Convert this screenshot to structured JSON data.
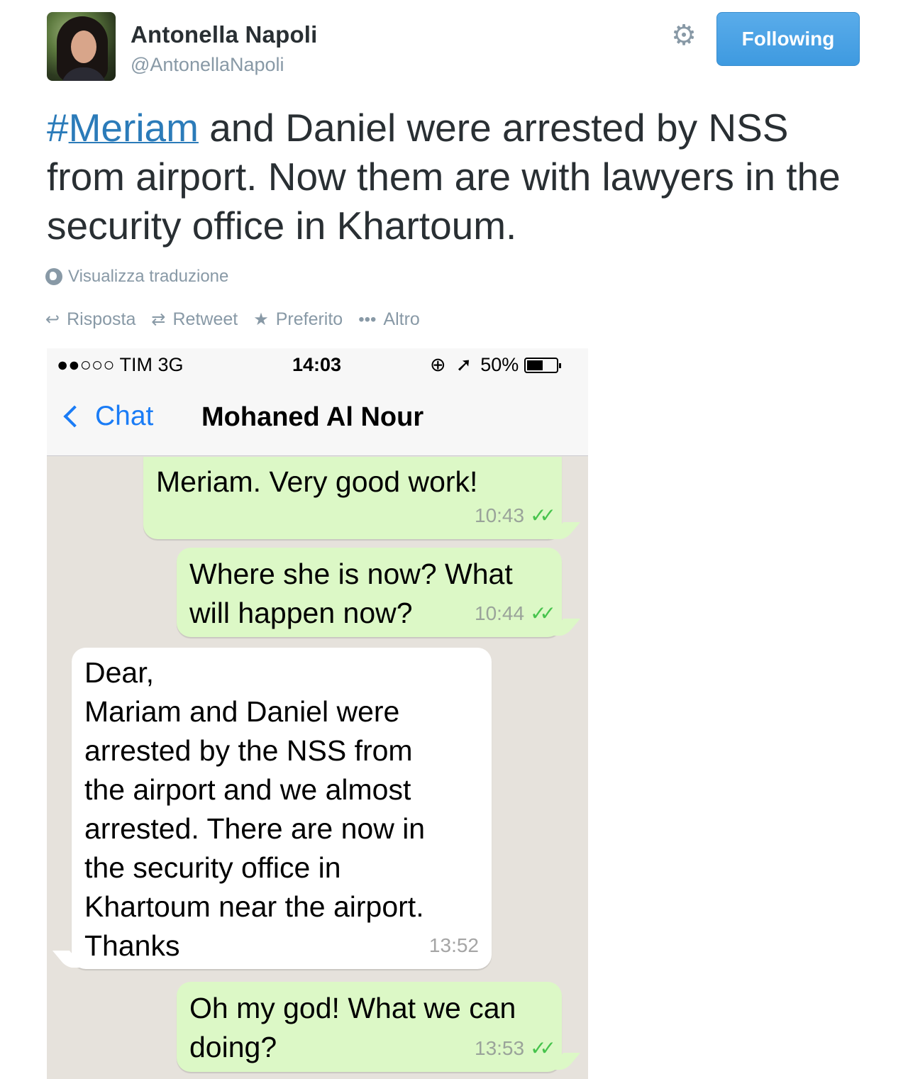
{
  "profile": {
    "name": "Antonella Napoli",
    "handle": "@AntonellaNapoli",
    "follow_label": "Following"
  },
  "tweet": {
    "hash": "#",
    "hashtag": "Meriam",
    "text": " and Daniel were arrested by NSS from airport. Now them are with lawyers in the security office in Khartoum.",
    "translate_label": "Visualizza traduzione"
  },
  "actions": {
    "reply": "Risposta",
    "retweet": "Retweet",
    "favorite": "Preferito",
    "more": "Altro"
  },
  "phone": {
    "status": {
      "carrier": "●●○○○ TIM   3G",
      "time": "14:03",
      "battery": "50%"
    },
    "nav": {
      "back_label": "Chat",
      "contact": "Mohaned Al Nour"
    },
    "messages": [
      {
        "direction": "out",
        "text": "Meriam. Very good work!",
        "time": "10:43"
      },
      {
        "direction": "out",
        "text": "Where she is now? What\nwill happen now?",
        "time": "10:44"
      },
      {
        "direction": "in",
        "text": "Dear,\nMariam and Daniel were\narrested by the NSS from\nthe airport and we almost\narrested. There are now in\nthe security office in\nKhartoum near the airport.\nThanks",
        "time": "13:52"
      },
      {
        "direction": "out",
        "text": "Oh my god! What we can\ndoing?",
        "time": "13:53"
      }
    ]
  },
  "colors": {
    "link": "#2b7bb9",
    "follow_button": "#4aa3e6",
    "outgoing_bubble": "#dcf8c6",
    "ios_blue": "#1a7cf6",
    "read_ticks": "#46c34c"
  },
  "icons": [
    "gear-icon",
    "globe-icon",
    "reply-icon",
    "retweet-icon",
    "star-icon",
    "more-icon",
    "back-chevron-icon",
    "location-icon",
    "battery-icon",
    "double-check-icon"
  ]
}
